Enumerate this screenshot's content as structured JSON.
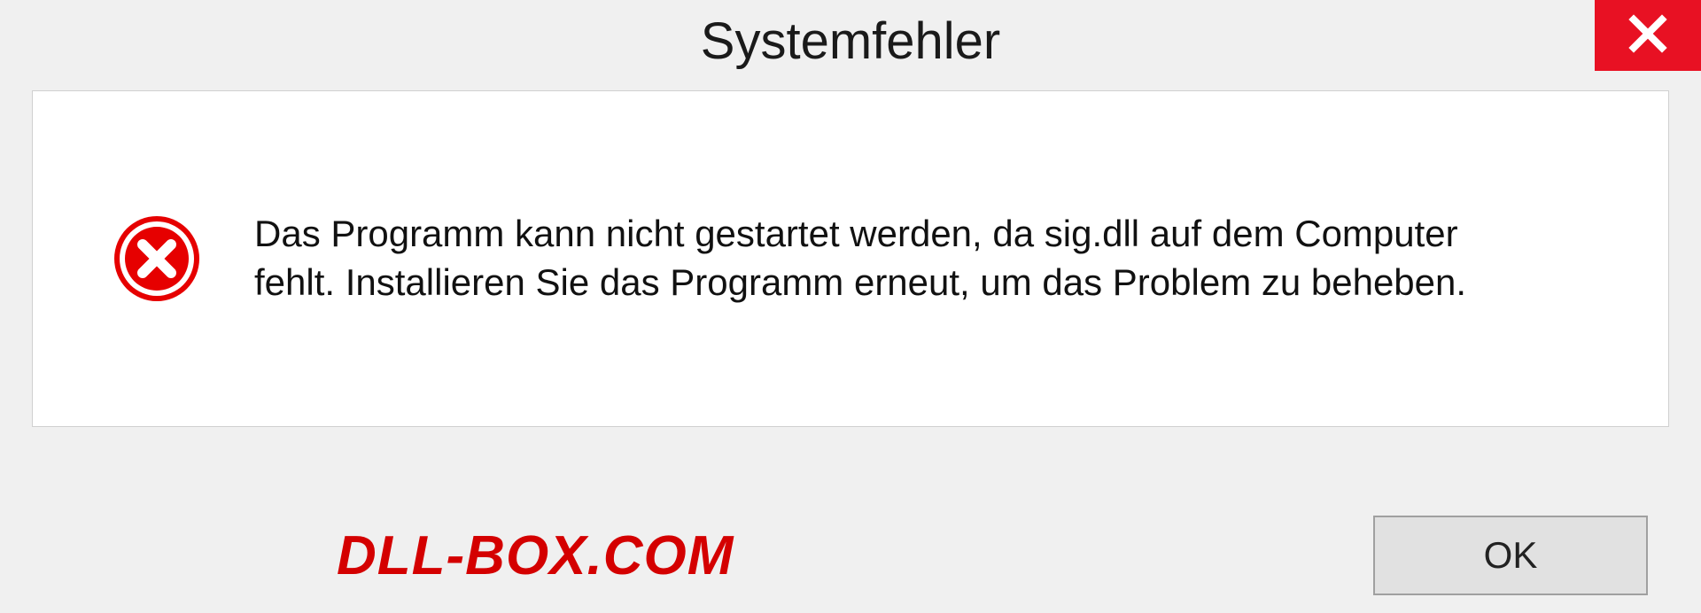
{
  "dialog": {
    "title": "Systemfehler",
    "message": "Das Programm kann nicht gestartet werden, da sig.dll auf dem Computer fehlt. Installieren Sie das Programm erneut, um das Problem zu beheben.",
    "ok_label": "OK"
  },
  "watermark": "DLL-BOX.COM",
  "colors": {
    "close_bg": "#e81123",
    "error_red": "#d40000"
  }
}
